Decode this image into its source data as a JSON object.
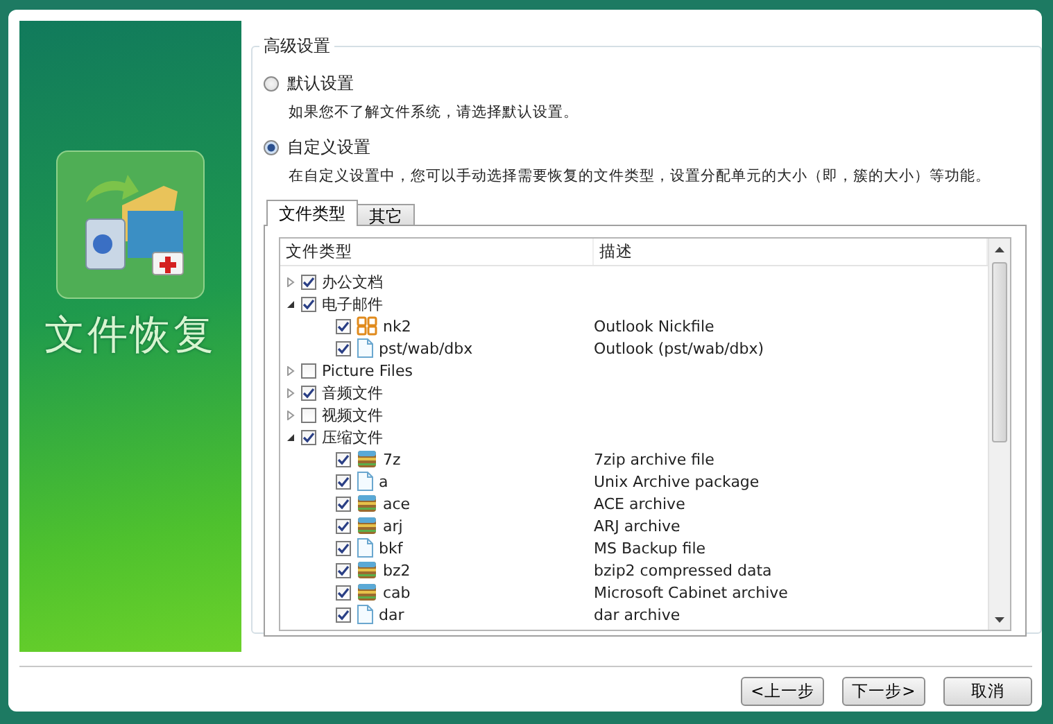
{
  "sidebar": {
    "title": "文件恢复"
  },
  "settings": {
    "title": "高级设置",
    "options": [
      {
        "label": "默认设置",
        "description": "如果您不了解文件系统，请选择默认设置。",
        "selected": false
      },
      {
        "label": "自定义设置",
        "description": "在自定义设置中，您可以手动选择需要恢复的文件类型，设置分配单元的大小（即，簇的大小）等功能。",
        "selected": true
      }
    ]
  },
  "tabs": [
    {
      "label": "文件类型",
      "selected": true
    },
    {
      "label": "其它",
      "selected": false
    }
  ],
  "file_types": {
    "columns": [
      "文件类型",
      "描述"
    ],
    "rows": [
      {
        "name": "办公文档",
        "checked": true,
        "expanded": false,
        "children": []
      },
      {
        "name": "电子邮件",
        "checked": true,
        "expanded": true,
        "children": [
          {
            "name": "nk2",
            "description": "Outlook Nickfile",
            "checked": true,
            "kind": "contacts"
          },
          {
            "name": "pst/wab/dbx",
            "description": "Outlook (pst/wab/dbx)",
            "checked": true,
            "kind": "document"
          }
        ]
      },
      {
        "name": "Picture Files",
        "checked": false,
        "expanded": false,
        "children": []
      },
      {
        "name": "音频文件",
        "checked": true,
        "expanded": false,
        "children": []
      },
      {
        "name": "视频文件",
        "checked": false,
        "expanded": false,
        "children": []
      },
      {
        "name": "压缩文件",
        "checked": true,
        "expanded": true,
        "children": [
          {
            "name": "7z",
            "description": "7zip archive file",
            "checked": true,
            "kind": "archive"
          },
          {
            "name": "a",
            "description": "Unix Archive package",
            "checked": true,
            "kind": "document"
          },
          {
            "name": "ace",
            "description": "ACE archive",
            "checked": true,
            "kind": "archive"
          },
          {
            "name": "arj",
            "description": "ARJ archive",
            "checked": true,
            "kind": "archive"
          },
          {
            "name": "bkf",
            "description": "MS Backup file",
            "checked": true,
            "kind": "document"
          },
          {
            "name": "bz2",
            "description": "bzip2 compressed data",
            "checked": true,
            "kind": "archive"
          },
          {
            "name": "cab",
            "description": "Microsoft Cabinet archive",
            "checked": true,
            "kind": "archive"
          },
          {
            "name": "dar",
            "description": "dar archive",
            "checked": true,
            "kind": "document"
          }
        ]
      }
    ]
  },
  "buttons": [
    "<上一步",
    "下一步>",
    "取消"
  ]
}
